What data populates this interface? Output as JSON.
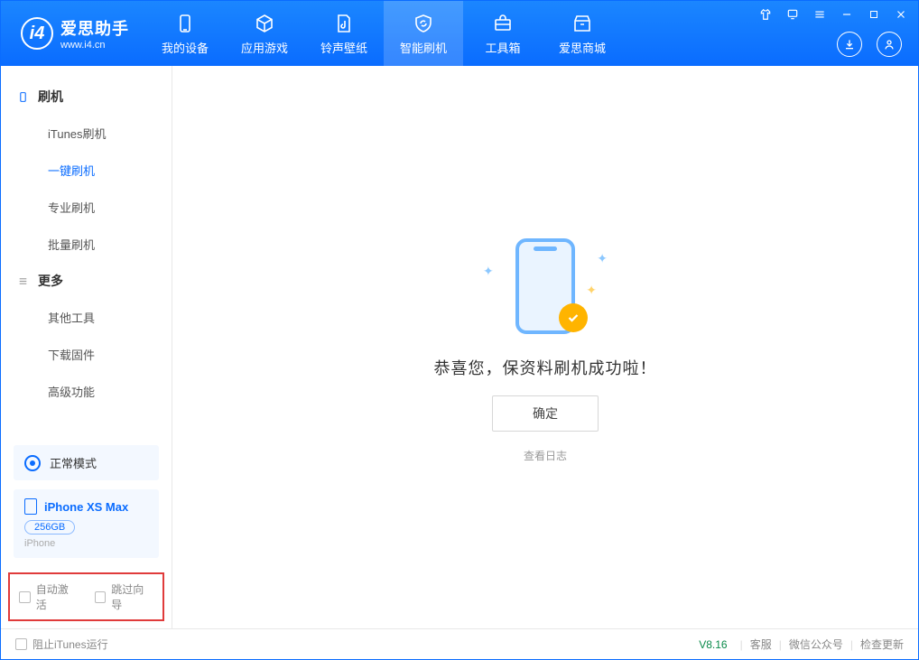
{
  "app": {
    "name": "爱思助手",
    "url": "www.i4.cn"
  },
  "nav": {
    "items": [
      {
        "label": "我的设备"
      },
      {
        "label": "应用游戏"
      },
      {
        "label": "铃声壁纸"
      },
      {
        "label": "智能刷机"
      },
      {
        "label": "工具箱"
      },
      {
        "label": "爱思商城"
      }
    ]
  },
  "sidebar": {
    "group_flash": "刷机",
    "group_more": "更多",
    "items": {
      "itunes": "iTunes刷机",
      "onekey": "一键刷机",
      "pro": "专业刷机",
      "batch": "批量刷机",
      "other": "其他工具",
      "firmware": "下载固件",
      "advanced": "高级功能"
    }
  },
  "device": {
    "mode": "正常模式",
    "name": "iPhone XS Max",
    "capacity": "256GB",
    "type": "iPhone"
  },
  "options": {
    "auto_activate": "自动激活",
    "skip_guide": "跳过向导"
  },
  "main": {
    "success": "恭喜您，保资料刷机成功啦！",
    "ok": "确定",
    "view_log": "查看日志"
  },
  "status": {
    "block_itunes": "阻止iTunes运行",
    "version": "V8.16",
    "support": "客服",
    "wechat": "微信公众号",
    "update": "检查更新"
  }
}
